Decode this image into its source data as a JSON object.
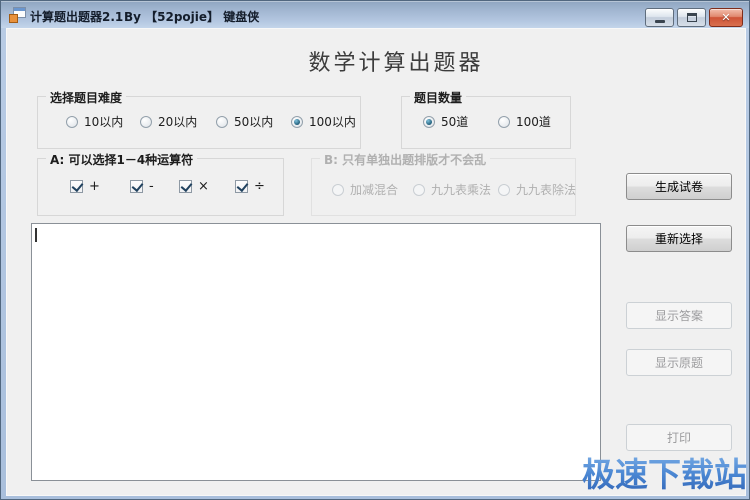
{
  "window": {
    "title": "计算题出题器2.1",
    "byline": "By 【52pojie】 键盘侠",
    "close_glyph": "✕"
  },
  "heading": "数学计算出题器",
  "groups": {
    "difficulty": {
      "label": "选择题目难度",
      "options": [
        {
          "label": "10以内",
          "selected": false
        },
        {
          "label": "20以内",
          "selected": false
        },
        {
          "label": "50以内",
          "selected": false
        },
        {
          "label": "100以内",
          "selected": true
        }
      ]
    },
    "count": {
      "label": "题目数量",
      "options": [
        {
          "label": "50道",
          "selected": true
        },
        {
          "label": "100道",
          "selected": false
        }
      ]
    },
    "operators": {
      "label": "A: 可以选择1－4种运算符",
      "options": [
        {
          "label": "+",
          "checked": true
        },
        {
          "label": "-",
          "checked": true
        },
        {
          "label": "×",
          "checked": true
        },
        {
          "label": "÷",
          "checked": true
        }
      ]
    },
    "layout": {
      "label": "B: 只有单独出题排版才不会乱",
      "disabled": true,
      "options": [
        {
          "label": "加减混合",
          "selected": false
        },
        {
          "label": "九九表乘法",
          "selected": false
        },
        {
          "label": "九九表除法",
          "selected": false
        }
      ]
    }
  },
  "actions": {
    "generate": "生成试卷",
    "reselect": "重新选择",
    "show_answers": "显示答案",
    "show_original": "显示原题",
    "print": "打印"
  },
  "output": {
    "value": ""
  },
  "watermark": "极速下载站",
  "colors": {
    "titlebar_top": "#8fa5c0",
    "titlebar_bottom": "#c3d5ea",
    "client_bg": "#f0f0f0",
    "close_button_red": "#ce5336",
    "radio_dot_blue": "#1c5874",
    "watermark_blue": "#3d76c6"
  }
}
